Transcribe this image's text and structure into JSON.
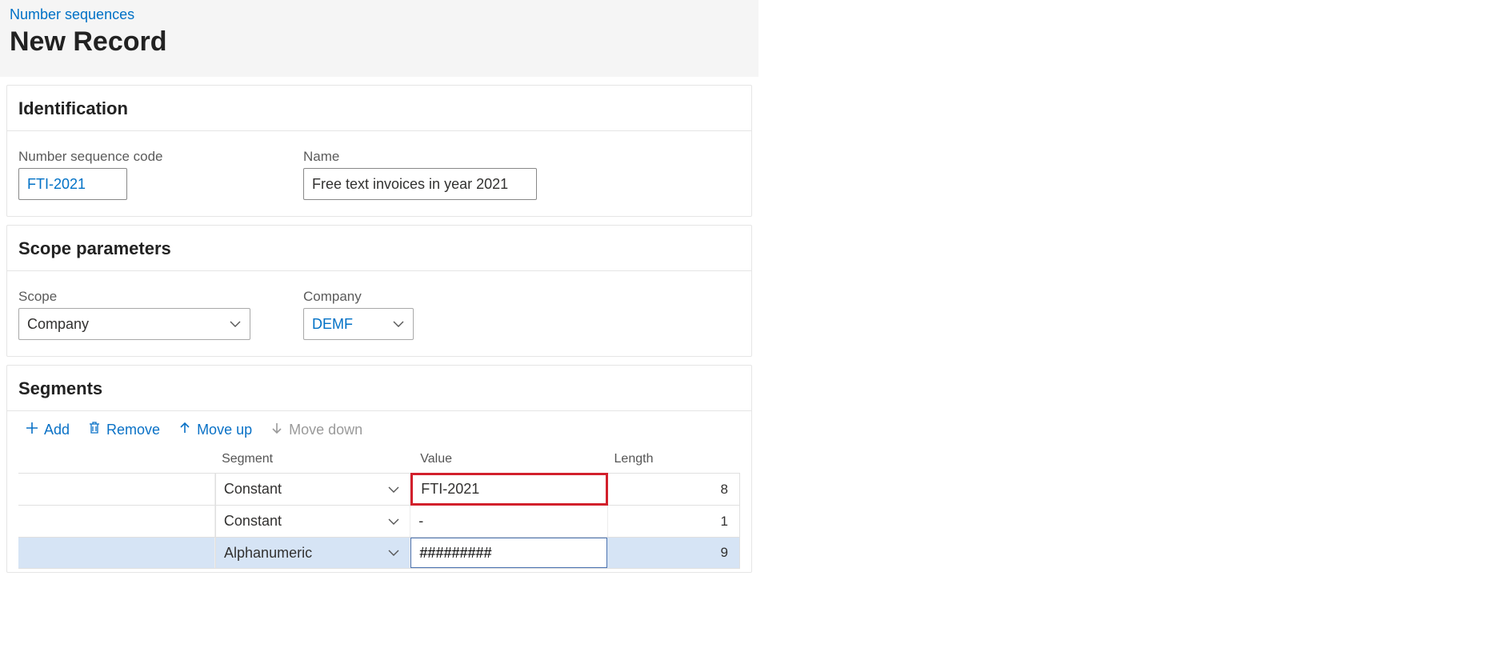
{
  "breadcrumb": "Number sequences",
  "page_title": "New Record",
  "identification": {
    "heading": "Identification",
    "code_label": "Number sequence code",
    "code_value": "FTI-2021",
    "name_label": "Name",
    "name_value": "Free text invoices in year 2021"
  },
  "scope": {
    "heading": "Scope parameters",
    "scope_label": "Scope",
    "scope_value": "Company",
    "company_label": "Company",
    "company_value": "DEMF"
  },
  "segments": {
    "heading": "Segments",
    "toolbar": {
      "add": "Add",
      "remove": "Remove",
      "move_up": "Move up",
      "move_down": "Move down"
    },
    "columns": {
      "segment": "Segment",
      "value": "Value",
      "length": "Length"
    },
    "rows": [
      {
        "segment": "Constant",
        "value": "FTI-2021",
        "length": "8"
      },
      {
        "segment": "Constant",
        "value": "-",
        "length": "1"
      },
      {
        "segment": "Alphanumeric",
        "value": "#########",
        "length": "9"
      }
    ]
  }
}
